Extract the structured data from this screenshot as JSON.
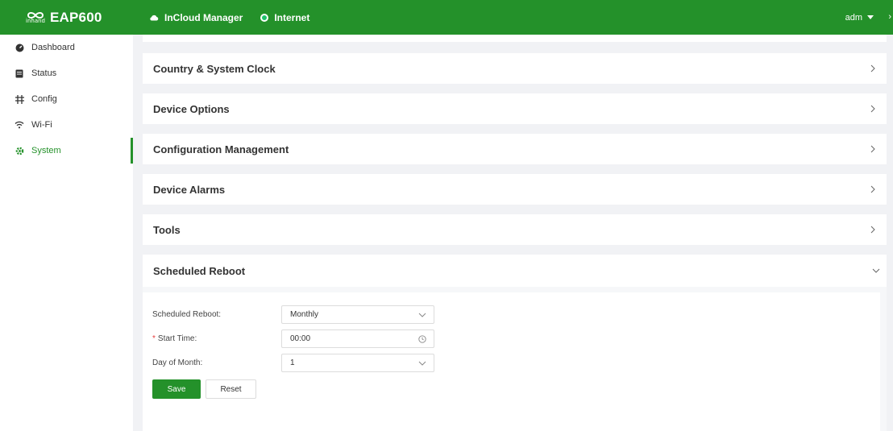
{
  "header": {
    "logo_text": "inhand",
    "product": "EAP600",
    "status_items": [
      {
        "label": "InCloud Manager",
        "icon": "cloud-icon"
      },
      {
        "label": "Internet",
        "icon": "status-dot-icon",
        "color": "#1fc36a"
      }
    ],
    "user": "adm",
    "edge_glyph": "›"
  },
  "sidebar": {
    "items": [
      {
        "label": "Dashboard",
        "icon": "dashboard-icon",
        "active": false
      },
      {
        "label": "Status",
        "icon": "status-icon",
        "active": false
      },
      {
        "label": "Config",
        "icon": "config-icon",
        "active": false
      },
      {
        "label": "Wi-Fi",
        "icon": "wifi-icon",
        "active": false
      },
      {
        "label": "System",
        "icon": "gear-icon",
        "active": true
      }
    ]
  },
  "panels": [
    {
      "title": "Country & System Clock",
      "expanded": false
    },
    {
      "title": "Device Options",
      "expanded": false
    },
    {
      "title": "Configuration Management",
      "expanded": false
    },
    {
      "title": "Device Alarms",
      "expanded": false
    },
    {
      "title": "Tools",
      "expanded": false
    }
  ],
  "scheduled_reboot": {
    "title": "Scheduled Reboot",
    "expanded": true,
    "fields": {
      "mode": {
        "label": "Scheduled Reboot:",
        "value": "Monthly"
      },
      "start_time": {
        "label": "Start Time:",
        "value": "00:00",
        "required": true
      },
      "day_of_month": {
        "label": "Day of Month:",
        "value": "1"
      }
    },
    "save_label": "Save",
    "reset_label": "Reset"
  },
  "colors": {
    "brand": "#24912a",
    "required": "#e53d3d",
    "background": "#f1f2f5"
  }
}
